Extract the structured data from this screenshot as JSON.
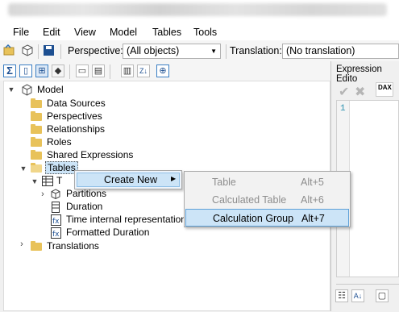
{
  "menu": {
    "items": [
      "File",
      "Edit",
      "View",
      "Model",
      "Tables",
      "Tools"
    ]
  },
  "toolbar": {
    "perspective_label": "Perspective:",
    "perspective_value": "(All objects)",
    "translation_label": "Translation:",
    "translation_value": "(No translation)"
  },
  "expression_editor": {
    "title": "Expression Edito",
    "line_number": "1",
    "dax_label": "DAX"
  },
  "tree": {
    "root": "Model",
    "folders": [
      "Data Sources",
      "Perspectives",
      "Relationships",
      "Roles",
      "Shared Expressions",
      "Tables"
    ],
    "table_name": "T",
    "table_children": [
      "Partitions",
      "Duration",
      "Time internal representation",
      "Formatted Duration"
    ],
    "translations": "Translations"
  },
  "context_menu": {
    "create_new": "Create New",
    "arrow": "▶"
  },
  "submenu": {
    "items": [
      {
        "label": "Table",
        "shortcut": "Alt+5",
        "enabled": false
      },
      {
        "label": "Calculated Table",
        "shortcut": "Alt+6",
        "enabled": false
      },
      {
        "label": "Calculation Group",
        "shortcut": "Alt+7",
        "enabled": true,
        "selected": true
      }
    ]
  }
}
